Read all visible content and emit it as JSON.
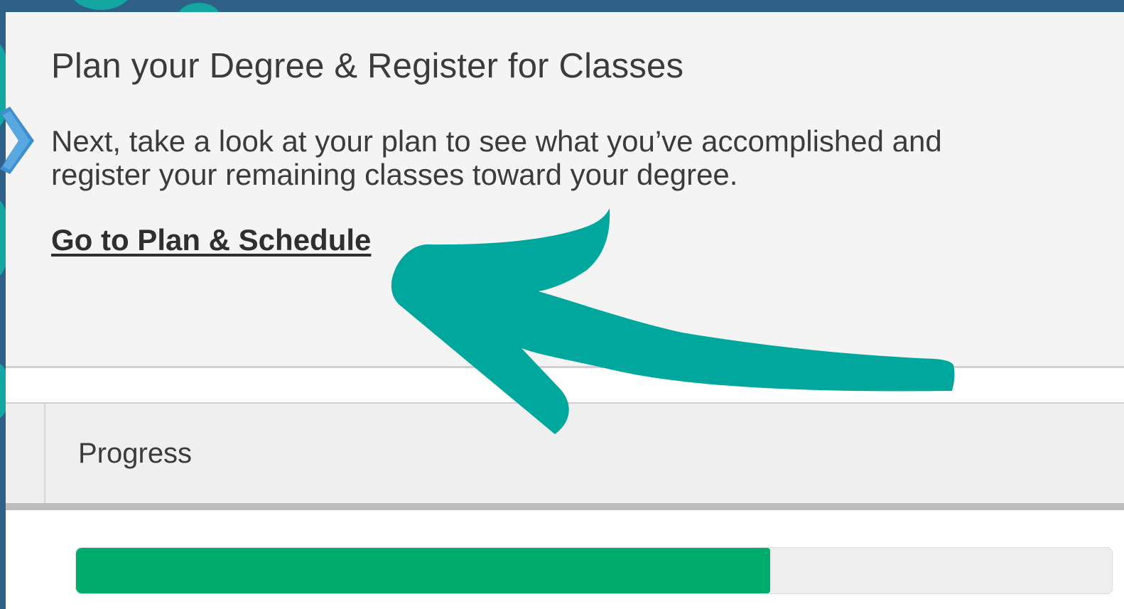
{
  "header": {
    "title": "Plan your Degree & Register for Classes",
    "intro": "Next, take a look at your plan to see what you’ve accomplished and\nregister your remaining classes toward your degree.",
    "link_label": "Go to Plan & Schedule"
  },
  "tabs": {
    "progress_label": "Progress"
  },
  "progress": {
    "fraction": 0.67,
    "fill_color": "#00ac6b"
  },
  "colors": {
    "background": "#2f6088",
    "accent": "#14a6a0",
    "panel": "#f4f4f4"
  },
  "icons": {
    "annotation": "curved-arrow-icon",
    "side_decoration": "chevron-right-icon"
  }
}
